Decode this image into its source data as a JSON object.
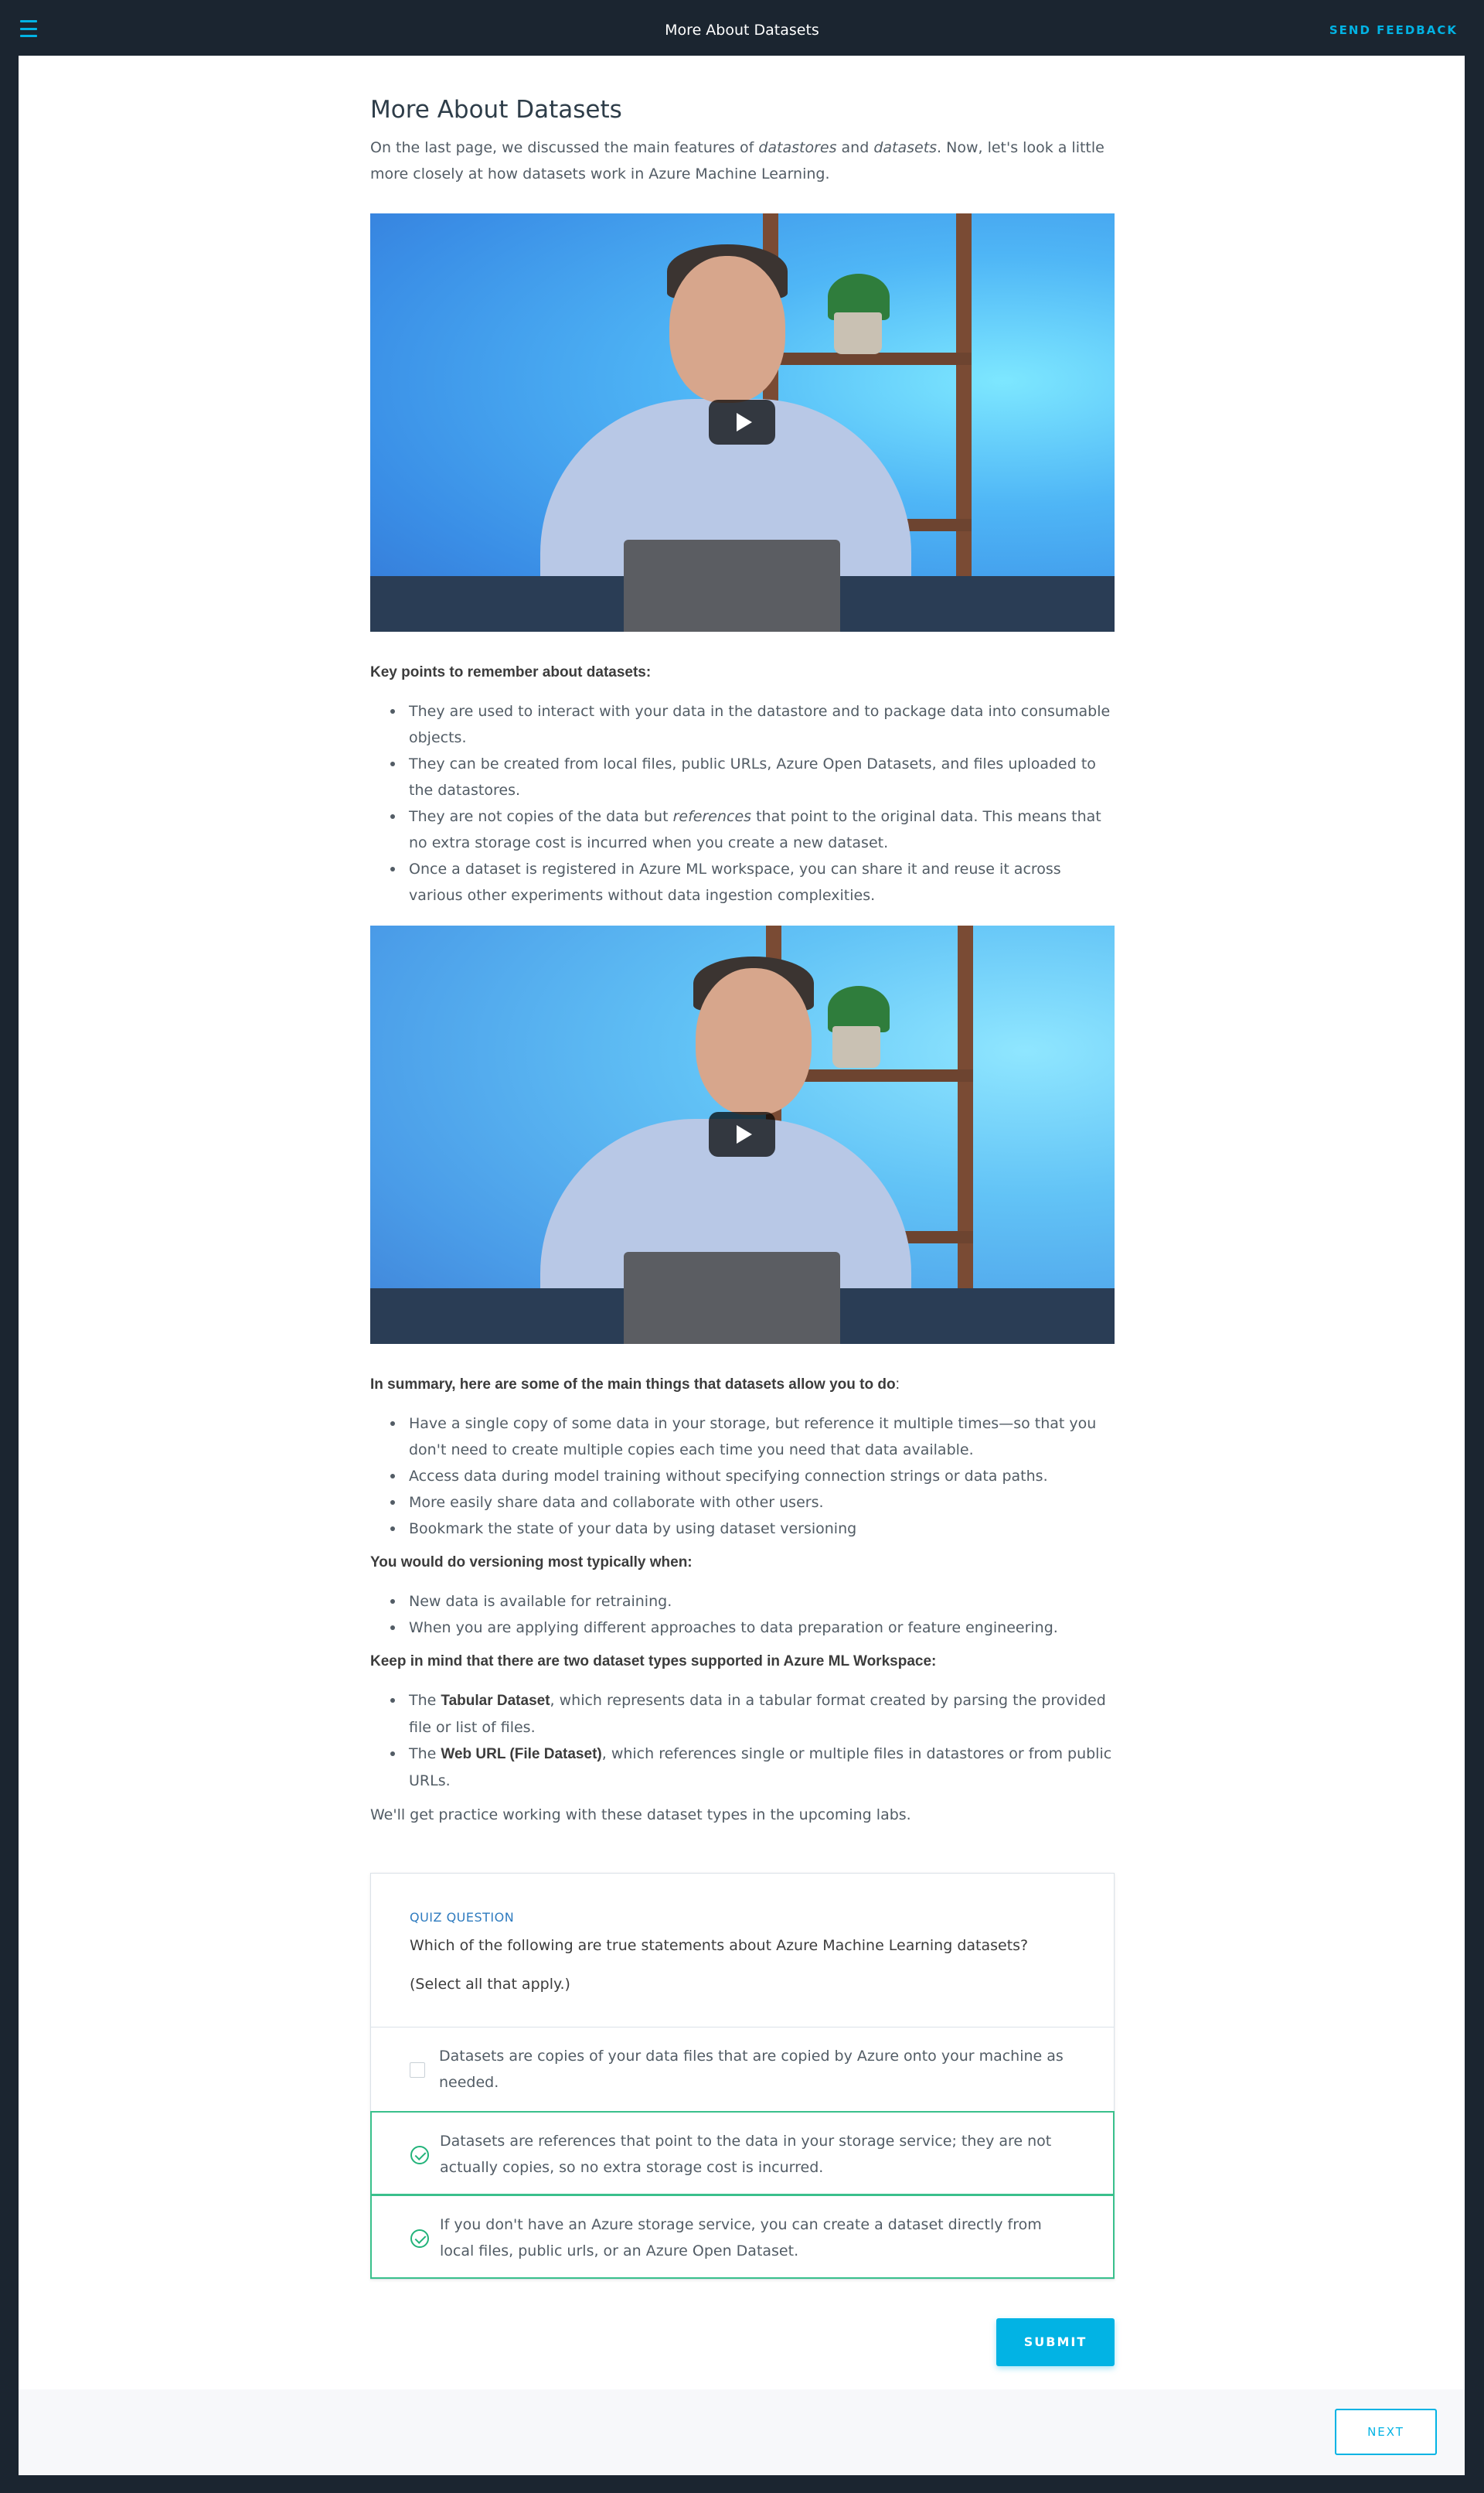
{
  "header": {
    "title": "More About Datasets",
    "feedback_label": "SEND FEEDBACK",
    "menu_icon": "hamburger-menu-icon"
  },
  "main": {
    "title": "More About Datasets",
    "intro": {
      "part1": "On the last page, we discussed the main features of ",
      "em1": "datastores",
      "part2": " and ",
      "em2": "datasets",
      "part3": ". Now, let's look a little more closely at how datasets work in Azure Machine Learning."
    },
    "video1": {
      "play_icon": "play-icon"
    },
    "key_points_heading": "Key points to remember about datasets:",
    "key_points": [
      "They are used to interact with your data in the datastore and to package data into consumable objects.",
      "They can be created from local files, public URLs, Azure Open Datasets, and files uploaded to the datastores.",
      {
        "pre": "They are not copies of the data but ",
        "em": "references",
        "post": " that point to the original data. This means that no extra storage cost is incurred when you create a new dataset."
      },
      "Once a dataset is registered in Azure ML workspace, you can share it and reuse it across various other experiments without data ingestion complexities."
    ],
    "video2": {
      "play_icon": "play-icon"
    },
    "summary_heading": "In summary, here are some of the main things that datasets allow you to do",
    "summary_colon": ":",
    "summary_points": [
      "Have a single copy of some data in your storage, but reference it multiple times—so that you don't need to create multiple copies each time you need that data available.",
      "Access data during model training without specifying connection strings or data paths.",
      "More easily share data and collaborate with other users.",
      "Bookmark the state of your data by using dataset versioning"
    ],
    "versioning_heading": "You would do versioning most typically when:",
    "versioning_points": [
      "New data is available for retraining.",
      "When you are applying different approaches to data preparation or feature engineering."
    ],
    "types_heading": "Keep in mind that there are two dataset types supported in Azure ML Workspace:",
    "types_points": [
      {
        "pre": "The ",
        "strong": "Tabular Dataset",
        "post": ", which represents data in a tabular format created by parsing the provided file or list of files."
      },
      {
        "pre": "The ",
        "strong": "Web URL (File Dataset)",
        "post": ", which references single or multiple files in datastores or from public URLs."
      }
    ],
    "closing": "We'll get practice working with these dataset types in the upcoming labs."
  },
  "quiz": {
    "label": "QUIZ QUESTION",
    "question": "Which of the following are true statements about Azure Machine Learning datasets?",
    "note": "(Select all that apply.)",
    "options": [
      {
        "text": "Datasets are copies of your data files that are copied by Azure onto your machine as needed.",
        "selected": false
      },
      {
        "text": "Datasets are references that point to the data in your storage service; they are not actually copies, so no extra storage cost is incurred.",
        "selected": true
      },
      {
        "text": "If you don't have an Azure storage service, you can create a dataset directly from local files, public urls, or an Azure Open Dataset.",
        "selected": true
      }
    ],
    "submit_label": "SUBMIT"
  },
  "footer": {
    "next_label": "NEXT"
  },
  "colors": {
    "accent": "#02b3e4",
    "correct": "#22b37a",
    "topbar": "#1b2530"
  }
}
